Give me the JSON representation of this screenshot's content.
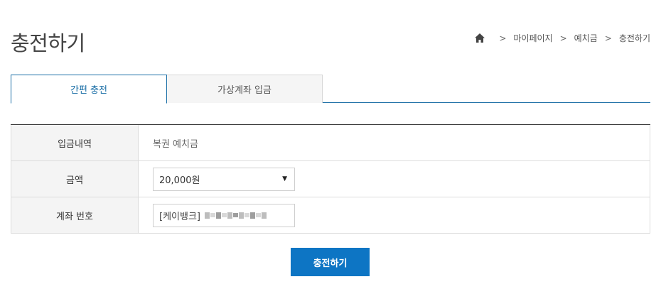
{
  "page_title": "충전하기",
  "breadcrumb": {
    "items": [
      "마이페이지",
      "예치금",
      "충전하기"
    ],
    "separator": ">"
  },
  "tabs": [
    {
      "label": "간편 충전",
      "active": true
    },
    {
      "label": "가상계좌 입금",
      "active": false
    }
  ],
  "form": {
    "rows": [
      {
        "label": "입금내역",
        "value": "복권 예치금"
      },
      {
        "label": "금액",
        "selected": "20,000원"
      },
      {
        "label": "계좌 번호",
        "value": "[케이뱅크]"
      }
    ]
  },
  "submit_label": "충전하기",
  "colors": {
    "accent": "#1a6ea6",
    "button": "#0d75c4",
    "header_bg": "#f4f4f4"
  }
}
